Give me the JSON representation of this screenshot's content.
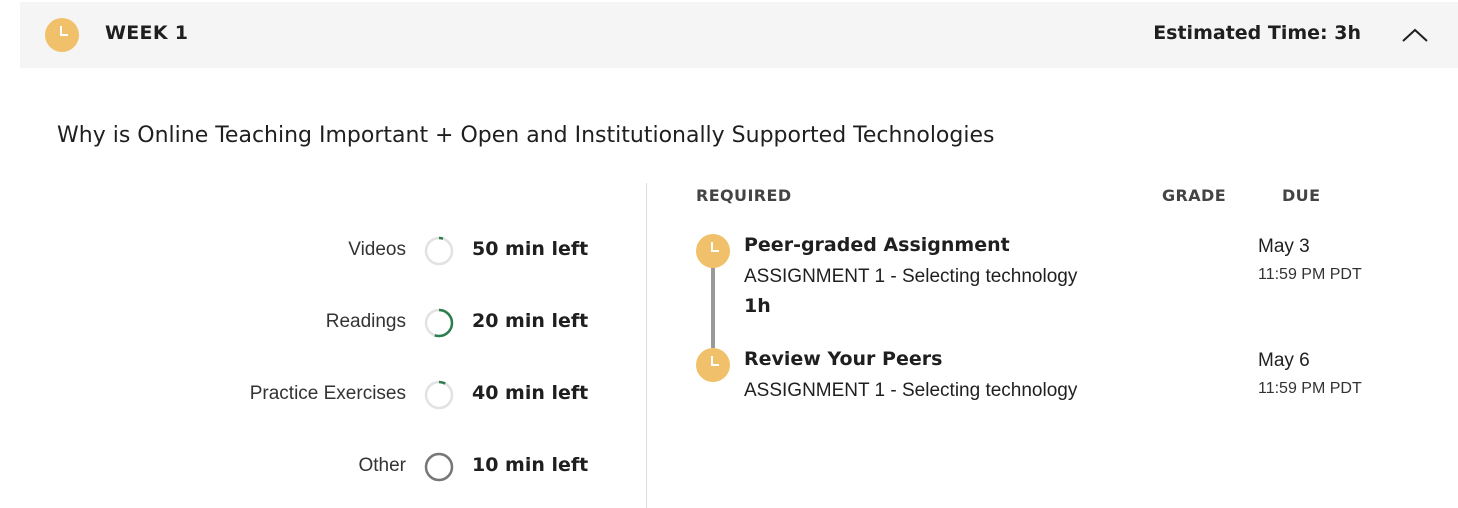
{
  "week": {
    "title": "WEEK 1",
    "estimated_time": "Estimated Time: 3h",
    "description": "Why is Online Teaching Important + Open and Institutionally Supported Technologies",
    "collapse_icon": "chevron-up-icon",
    "status_icon": "clock-icon"
  },
  "progress": [
    {
      "label": "Videos",
      "time_left": "50 min left",
      "completion": 0.05
    },
    {
      "label": "Readings",
      "time_left": "20 min left",
      "completion": 0.55
    },
    {
      "label": "Practice Exercises",
      "time_left": "40 min left",
      "completion": 0.08
    },
    {
      "label": "Other",
      "time_left": "10 min left",
      "completion": 1.0
    }
  ],
  "columns": {
    "required": "REQUIRED",
    "grade": "GRADE",
    "due": "DUE"
  },
  "items": [
    {
      "title": "Peer-graded Assignment",
      "subtitle": "ASSIGNMENT 1 - Selecting technology",
      "duration": "1h",
      "due_date": "May 3",
      "due_time": "11:59 PM PDT"
    },
    {
      "title": "Review Your Peers",
      "subtitle": "ASSIGNMENT 1 - Selecting technology",
      "due_date": "May 6",
      "due_time": "11:59 PM PDT"
    }
  ],
  "colors": {
    "accent": "#f0c06a",
    "progress_green": "#2e7d4f",
    "progress_gray": "#777777",
    "header_bg": "#f5f5f5"
  }
}
